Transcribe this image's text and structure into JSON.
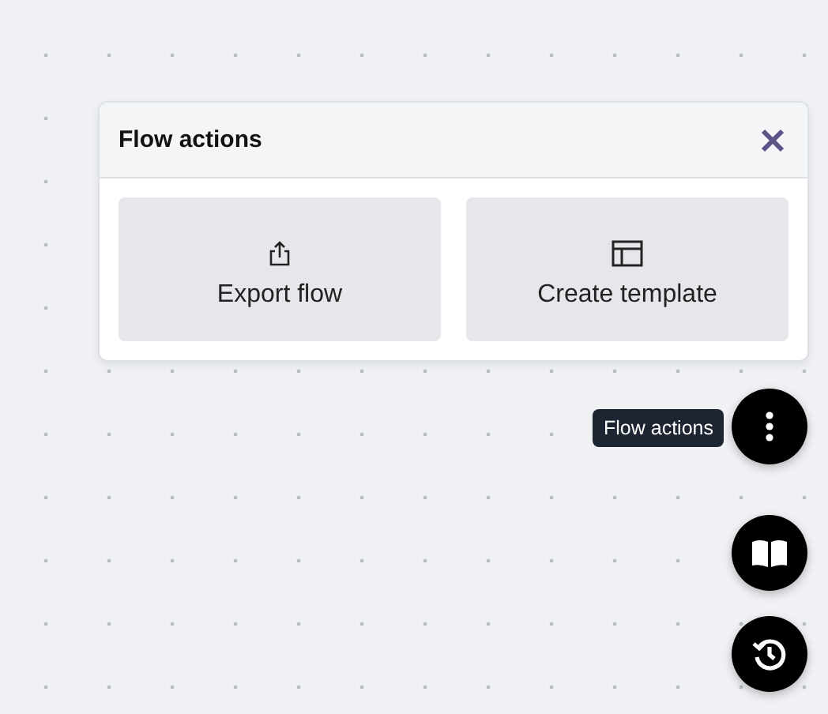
{
  "panel": {
    "title": "Flow actions",
    "actions": [
      {
        "label": "Export flow"
      },
      {
        "label": "Create template"
      }
    ]
  },
  "tooltip": {
    "text": "Flow actions"
  }
}
